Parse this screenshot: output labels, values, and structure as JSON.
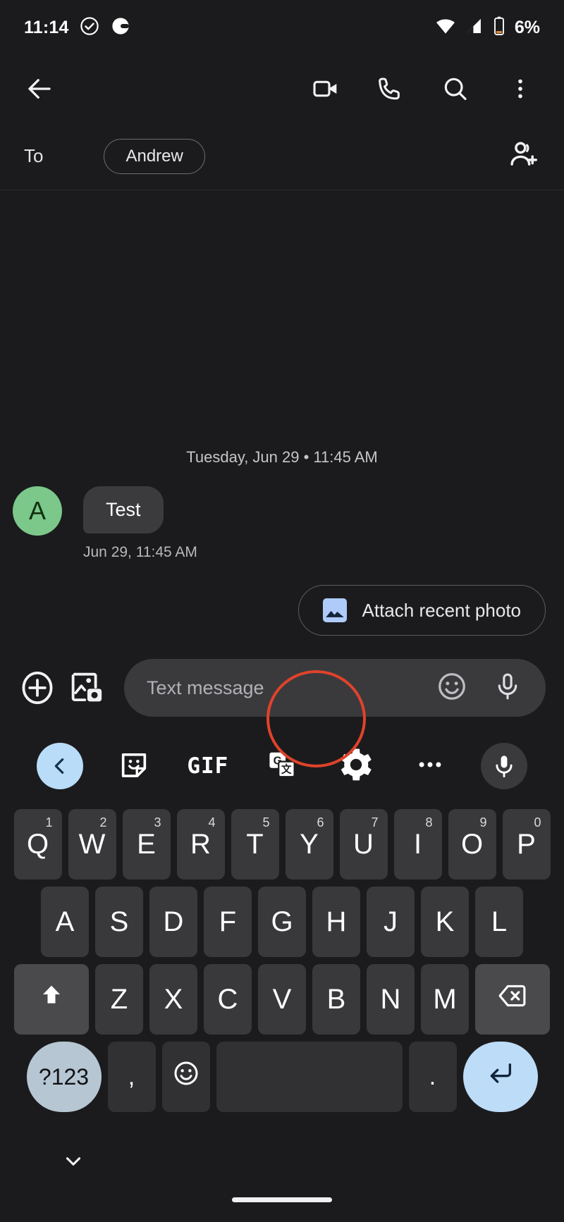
{
  "status_bar": {
    "time": "11:14",
    "icons_left": [
      "check-circle-icon",
      "pill-capsule-icon"
    ],
    "icons_right": [
      "wifi-icon",
      "signal-icon",
      "battery-icon"
    ],
    "battery_text": "6%"
  },
  "app_bar": {
    "back": "back-arrow-icon",
    "actions": [
      "video-call-icon",
      "phone-call-icon",
      "search-icon",
      "overflow-menu-icon"
    ]
  },
  "recipient": {
    "to_label": "To",
    "chip_name": "Andrew",
    "add_person": "add-person-icon"
  },
  "conversation": {
    "day_divider": "Tuesday, Jun 29 • 11:45 AM",
    "messages": [
      {
        "avatar_letter": "A",
        "avatar_color": "#7bc88a",
        "text": "Test",
        "timestamp": "Jun 29, 11:45 AM"
      }
    ],
    "suggestion_chip": {
      "label": "Attach recent photo",
      "icon": "image-icon",
      "icon_color": "#aecbfa"
    }
  },
  "compose": {
    "plus_icon": "plus-circle-icon",
    "gallery_icon": "gallery-camera-icon",
    "placeholder": "Text message",
    "value": "",
    "emoji_icon": "emoji-smiley-icon",
    "mic_icon": "microphone-icon"
  },
  "keyboard_toolbar": {
    "items": [
      {
        "name": "expand-toolbar-back",
        "icon": "chevron-left-icon",
        "accent": "#b9dcf8"
      },
      {
        "name": "sticker",
        "icon": "sticker-icon"
      },
      {
        "name": "gif",
        "label": "GIF"
      },
      {
        "name": "translate",
        "icon": "translate-icon"
      },
      {
        "name": "settings",
        "icon": "gear-icon"
      },
      {
        "name": "more",
        "icon": "more-horizontal-icon"
      },
      {
        "name": "voice-input",
        "icon": "microphone-icon"
      }
    ]
  },
  "keyboard": {
    "row1": [
      {
        "key": "Q",
        "num": "1"
      },
      {
        "key": "W",
        "num": "2"
      },
      {
        "key": "E",
        "num": "3"
      },
      {
        "key": "R",
        "num": "4"
      },
      {
        "key": "T",
        "num": "5"
      },
      {
        "key": "Y",
        "num": "6"
      },
      {
        "key": "U",
        "num": "7"
      },
      {
        "key": "I",
        "num": "8"
      },
      {
        "key": "O",
        "num": "9"
      },
      {
        "key": "P",
        "num": "0"
      }
    ],
    "row2": [
      "A",
      "S",
      "D",
      "F",
      "G",
      "H",
      "J",
      "K",
      "L"
    ],
    "row3": {
      "shift": "shift-arrow-icon",
      "letters": [
        "Z",
        "X",
        "C",
        "V",
        "B",
        "N",
        "M"
      ],
      "backspace": "backspace-icon"
    },
    "row4": {
      "symbols_label": "?123",
      "comma": ",",
      "emoji": "emoji-smiley-icon",
      "space": "",
      "period": ".",
      "enter": "enter-return-icon"
    }
  },
  "nav_bar": {
    "hide_keyboard": "chevron-down-icon",
    "home_indicator": "home-indicator"
  },
  "annotation": {
    "highlight_color": "#e0432a",
    "target": "gear-icon"
  }
}
